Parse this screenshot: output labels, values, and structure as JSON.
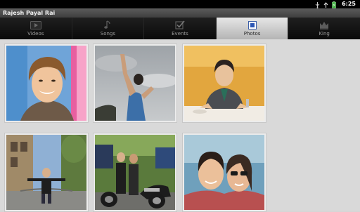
{
  "status_bar": {
    "time": "6:25",
    "icons": [
      "usb-icon",
      "upload-icon",
      "battery-charging-icon"
    ]
  },
  "app": {
    "title": "Rajesh Payal Rai"
  },
  "tabs": [
    {
      "label": "Videos",
      "icon": "video-icon",
      "active": false
    },
    {
      "label": "Songs",
      "icon": "music-note-icon",
      "active": false
    },
    {
      "label": "Events",
      "icon": "checkmark-icon",
      "active": false
    },
    {
      "label": "Photos",
      "icon": "photo-icon",
      "active": true
    },
    {
      "label": "King",
      "icon": "crown-icon",
      "active": false
    }
  ],
  "gallery": {
    "photos": [
      {
        "id": 1,
        "description": "smiling man portrait"
      },
      {
        "id": 2,
        "description": "man posing against cloudy sky"
      },
      {
        "id": 3,
        "description": "man at dinner table"
      },
      {
        "id": 4,
        "description": "man arms outstretched on street"
      },
      {
        "id": 5,
        "description": "two men with motorbikes"
      },
      {
        "id": 6,
        "description": "couple selfie"
      }
    ]
  },
  "colors": {
    "tab_active": "#d4d4d4",
    "tab_bar": "#0f0f0f",
    "title_bar": "#4c4c4c",
    "background": "#d9d9d9"
  }
}
